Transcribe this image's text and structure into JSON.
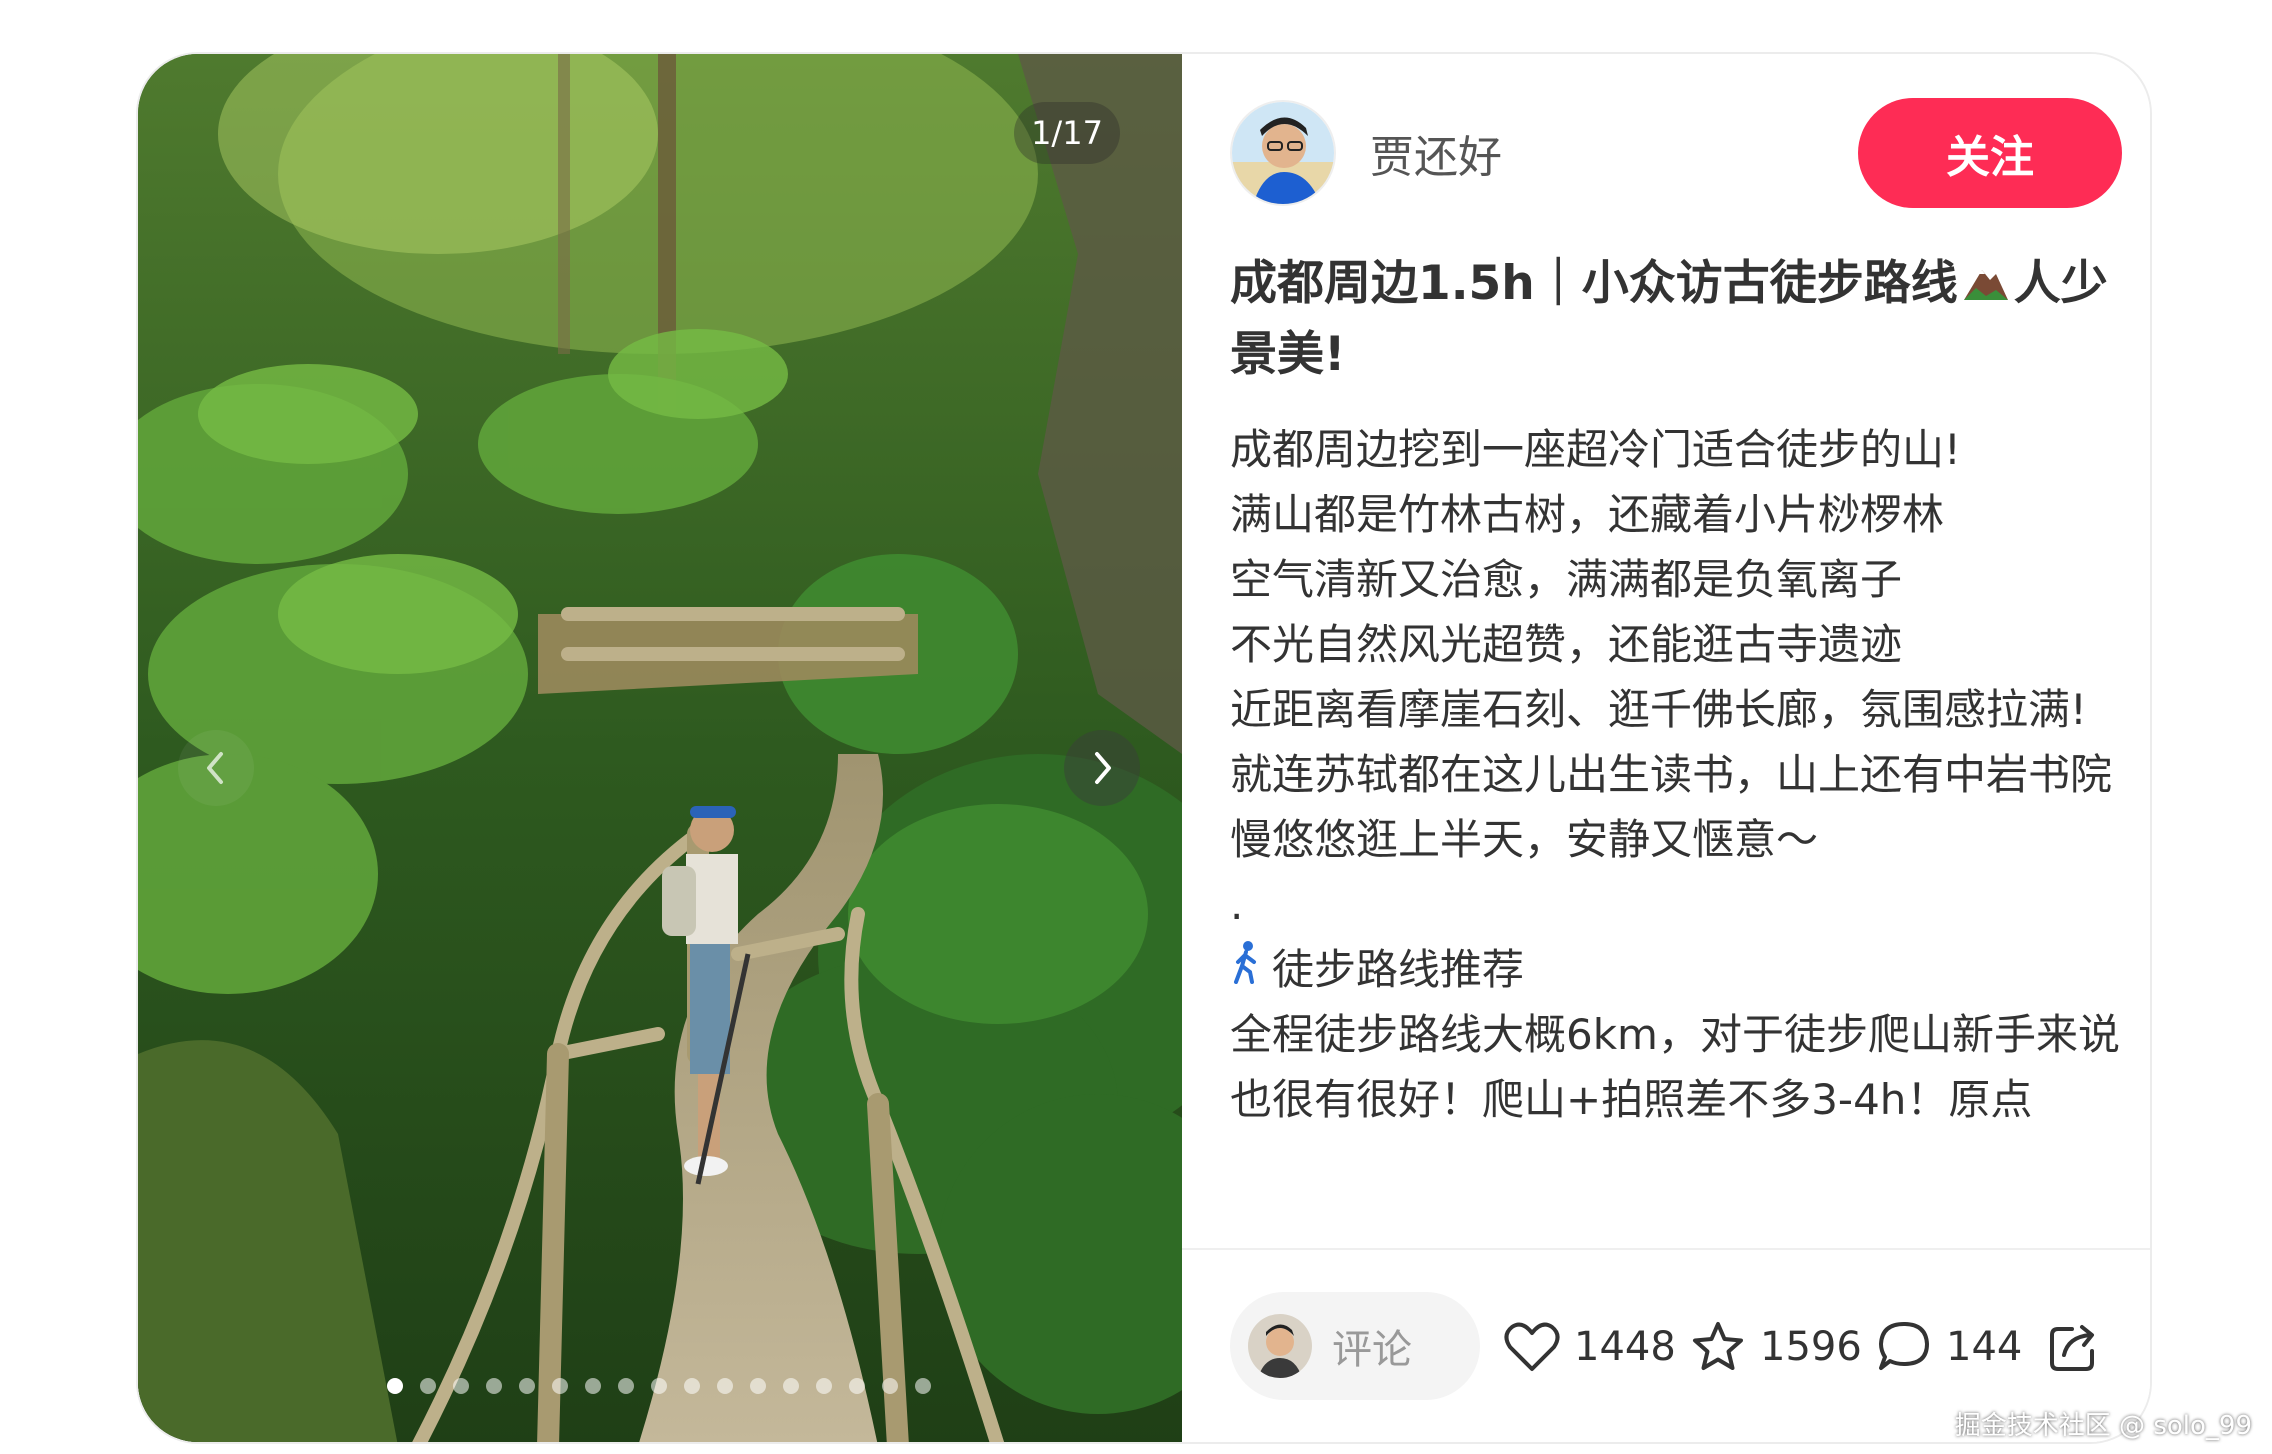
{
  "media": {
    "counter": "1/17",
    "total_images": 17,
    "current_index": 1,
    "prev_icon": "chevron-left-icon",
    "next_icon": "chevron-right-icon"
  },
  "author": {
    "name": "贾还好",
    "follow_label": "关注",
    "follow_color": "#fe2c55"
  },
  "post": {
    "title_part1": "成都周边1.5h｜小众访古徒步路线",
    "title_emoji": "mountain-icon",
    "title_part2": "人少景美!",
    "lines": [
      "成都周边挖到一座超冷门适合徒步的山!",
      "满山都是竹林古树，还藏着小片桫椤林",
      "空气清新又治愈，满满都是负氧离子",
      "不光自然风光超赞，还能逛古寺遗迹",
      "近距离看摩崖石刻、逛千佛长廊，氛围感拉满!",
      "就连苏轼都在这儿出生读书，山上还有中岩书院",
      "慢悠悠逛上半天，安静又惬意～",
      "."
    ],
    "section_icon": "walking-person-icon",
    "section_title": "徒步路线推荐",
    "section_lines": [
      "全程徒步路线大概6km，对于徒步爬山新手来说也很有很好！爬山+拍照差不多3-4h！原点"
    ]
  },
  "actions": {
    "comment_placeholder": "评论",
    "likes": "1448",
    "collects": "1596",
    "comments": "144",
    "like_icon": "heart-icon",
    "collect_icon": "star-icon",
    "comment_icon": "comment-bubble-icon",
    "share_icon": "share-icon"
  },
  "watermark": "掘金技术社区 @ solo_99"
}
